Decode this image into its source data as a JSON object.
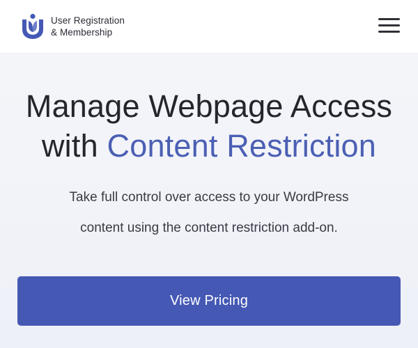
{
  "header": {
    "logo_icon": "user-registration-logo-icon",
    "logo_line1": "User Registration",
    "logo_line2": "& Membership",
    "menu_icon": "hamburger-menu-icon"
  },
  "hero": {
    "title_line1": "Manage Webpage Access",
    "title_line2_prefix": "with ",
    "title_line2_accent": "Content Restriction",
    "subtitle_line1": "Take full control over access to your WordPress",
    "subtitle_line2": "content using the content restriction add-on.",
    "cta_label": "View Pricing"
  },
  "colors": {
    "brand": "#4558b4",
    "accent_text": "#4b5fb3",
    "heading": "#25252c"
  }
}
